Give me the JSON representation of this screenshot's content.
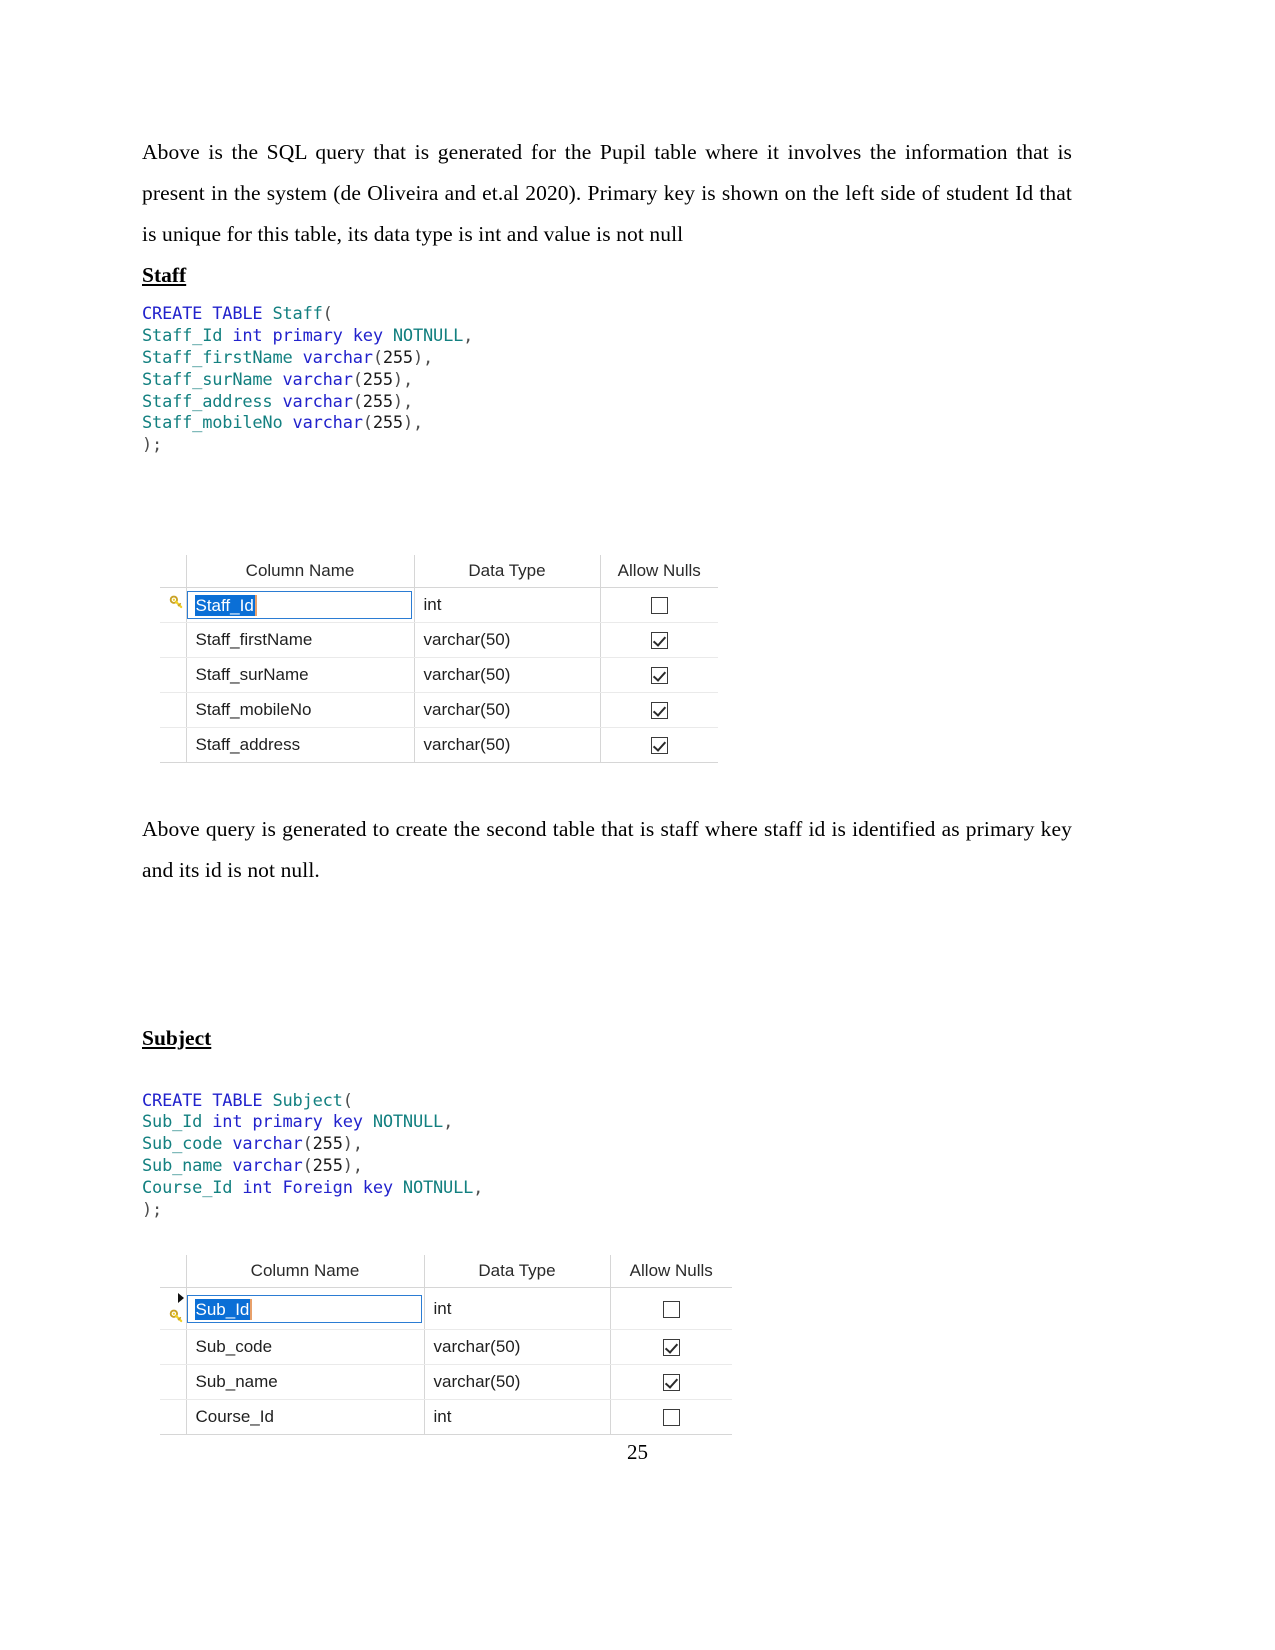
{
  "document": {
    "page_number": "25",
    "paragraphs": {
      "intro": "Above is the SQL query that is generated for the Pupil table where it involves the information that is present in the system (de Oliveira and et.al 2020). Primary key is shown on the left side of student Id that is unique for this table, its data type is int and value is not null",
      "after_staff_table": "Above query is generated to create the second table that is staff where staff id is identified as primary key and its id is not null."
    },
    "sections": [
      {
        "heading": "Staff",
        "sql": {
          "lines": [
            [
              {
                "t": "CREATE TABLE ",
                "c": "kw"
              },
              {
                "t": "Staff",
                "c": "ident"
              },
              {
                "t": "(",
                "c": "punc"
              }
            ],
            [
              {
                "t": "Staff_Id ",
                "c": "ident"
              },
              {
                "t": "int primary key ",
                "c": "kw"
              },
              {
                "t": "NOTNULL",
                "c": "ident"
              },
              {
                "t": ",",
                "c": "punc"
              }
            ],
            [
              {
                "t": "Staff_firstName ",
                "c": "ident"
              },
              {
                "t": "varchar",
                "c": "kw"
              },
              {
                "t": "(",
                "c": "punc"
              },
              {
                "t": "255",
                "c": "num"
              },
              {
                "t": "),",
                "c": "punc"
              }
            ],
            [
              {
                "t": "Staff_surName ",
                "c": "ident"
              },
              {
                "t": "varchar",
                "c": "kw"
              },
              {
                "t": "(",
                "c": "punc"
              },
              {
                "t": "255",
                "c": "num"
              },
              {
                "t": "),",
                "c": "punc"
              }
            ],
            [
              {
                "t": "Staff_address ",
                "c": "ident"
              },
              {
                "t": "varchar",
                "c": "kw"
              },
              {
                "t": "(",
                "c": "punc"
              },
              {
                "t": "255",
                "c": "num"
              },
              {
                "t": "),",
                "c": "punc"
              }
            ],
            [
              {
                "t": "Staff_mobileNo ",
                "c": "ident"
              },
              {
                "t": "varchar",
                "c": "kw"
              },
              {
                "t": "(",
                "c": "punc"
              },
              {
                "t": "255",
                "c": "num"
              },
              {
                "t": "),",
                "c": "punc"
              }
            ],
            [
              {
                "t": ");",
                "c": "punc"
              }
            ]
          ]
        },
        "grid": {
          "headers": [
            "Column Name",
            "Data Type",
            "Allow Nulls"
          ],
          "rows": [
            {
              "column_name": "Staff_Id",
              "data_type": "int",
              "allow_nulls": false,
              "selected": true,
              "key_icon": true,
              "arrow_icon": false
            },
            {
              "column_name": "Staff_firstName",
              "data_type": "varchar(50)",
              "allow_nulls": true,
              "selected": false,
              "key_icon": false,
              "arrow_icon": false
            },
            {
              "column_name": "Staff_surName",
              "data_type": "varchar(50)",
              "allow_nulls": true,
              "selected": false,
              "key_icon": false,
              "arrow_icon": false
            },
            {
              "column_name": "Staff_mobileNo",
              "data_type": "varchar(50)",
              "allow_nulls": true,
              "selected": false,
              "key_icon": false,
              "arrow_icon": false
            },
            {
              "column_name": "Staff_address",
              "data_type": "varchar(50)",
              "allow_nulls": true,
              "selected": false,
              "key_icon": false,
              "arrow_icon": false
            }
          ]
        }
      },
      {
        "heading": "Subject",
        "sql": {
          "lines": [
            [
              {
                "t": "CREATE TABLE ",
                "c": "kw"
              },
              {
                "t": "Subject",
                "c": "ident"
              },
              {
                "t": "(",
                "c": "punc"
              }
            ],
            [
              {
                "t": "Sub_Id ",
                "c": "ident"
              },
              {
                "t": "int primary key ",
                "c": "kw"
              },
              {
                "t": "NOTNULL",
                "c": "ident"
              },
              {
                "t": ",",
                "c": "punc"
              }
            ],
            [
              {
                "t": "Sub_code ",
                "c": "ident"
              },
              {
                "t": "varchar",
                "c": "kw"
              },
              {
                "t": "(",
                "c": "punc"
              },
              {
                "t": "255",
                "c": "num"
              },
              {
                "t": "),",
                "c": "punc"
              }
            ],
            [
              {
                "t": "Sub_name ",
                "c": "ident"
              },
              {
                "t": "varchar",
                "c": "kw"
              },
              {
                "t": "(",
                "c": "punc"
              },
              {
                "t": "255",
                "c": "num"
              },
              {
                "t": "),",
                "c": "punc"
              }
            ],
            [
              {
                "t": "Course_Id ",
                "c": "ident"
              },
              {
                "t": "int Foreign key ",
                "c": "kw"
              },
              {
                "t": "NOTNULL",
                "c": "ident"
              },
              {
                "t": ",",
                "c": "punc"
              }
            ],
            [
              {
                "t": ");",
                "c": "punc"
              }
            ]
          ]
        },
        "grid": {
          "headers": [
            "Column Name",
            "Data Type",
            "Allow Nulls"
          ],
          "rows": [
            {
              "column_name": "Sub_Id",
              "data_type": "int",
              "allow_nulls": false,
              "selected": true,
              "key_icon": true,
              "arrow_icon": true
            },
            {
              "column_name": "Sub_code",
              "data_type": "varchar(50)",
              "allow_nulls": true,
              "selected": false,
              "key_icon": false,
              "arrow_icon": false
            },
            {
              "column_name": "Sub_name",
              "data_type": "varchar(50)",
              "allow_nulls": true,
              "selected": false,
              "key_icon": false,
              "arrow_icon": false
            },
            {
              "column_name": "Course_Id",
              "data_type": "int",
              "allow_nulls": false,
              "selected": false,
              "key_icon": false,
              "arrow_icon": false
            }
          ]
        }
      }
    ],
    "colors": {
      "keyword": "#2222cc",
      "identifier": "#138080",
      "punctuation": "#4d4d4d",
      "selection": "#0b6fd6",
      "cell_border": "#2b7cd3",
      "key_icon": "#f2d024"
    }
  }
}
